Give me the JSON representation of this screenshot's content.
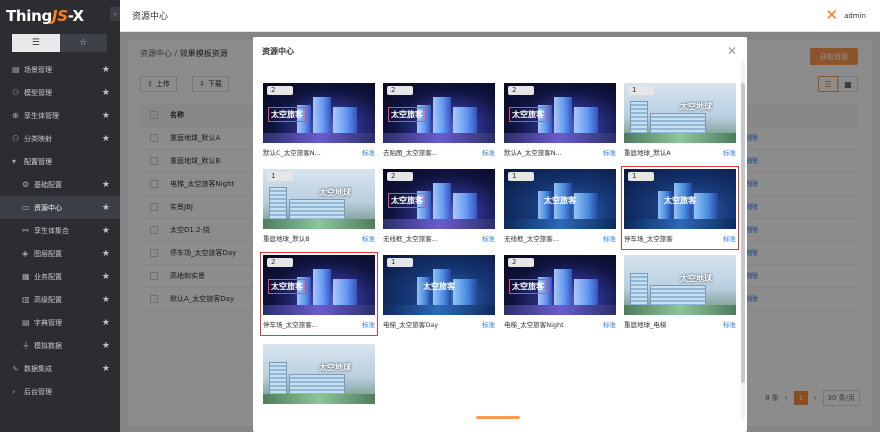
{
  "app": {
    "logo_main": "Thing",
    "logo_js": "JS",
    "logo_x": "-X"
  },
  "sidebar": {
    "collapse_icon": "‹",
    "mode_list_icon": "☰",
    "mode_fav_icon": "☆",
    "items": [
      {
        "label": "场景管理",
        "icon": "▤",
        "star": "★"
      },
      {
        "label": "模型管理",
        "icon": "⚇",
        "star": "★"
      },
      {
        "label": "孪生体管理",
        "icon": "⊕",
        "star": "★"
      },
      {
        "label": "分类映射",
        "icon": "⚇",
        "star": "★"
      },
      {
        "label": "配置管理",
        "icon": "▾",
        "star": ""
      },
      {
        "label": "基础配置",
        "icon": "⚙",
        "star": "★"
      },
      {
        "label": "资源中心",
        "icon": "▭",
        "star": "★"
      },
      {
        "label": "孪生体集合",
        "icon": "⚯",
        "star": "★"
      },
      {
        "label": "图层配置",
        "icon": "◈",
        "star": "★"
      },
      {
        "label": "业务配置",
        "icon": "▦",
        "star": "★"
      },
      {
        "label": "高级配置",
        "icon": "▥",
        "star": "★"
      },
      {
        "label": "字典管理",
        "icon": "▤",
        "star": "★"
      },
      {
        "label": "模拟数据",
        "icon": "⏚",
        "star": "★"
      },
      {
        "label": "数据集成",
        "icon": "∿",
        "star": "★"
      },
      {
        "label": "后台管理",
        "icon": "›",
        "star": ""
      }
    ]
  },
  "topbar": {
    "title": "资源中心",
    "user": "admin"
  },
  "page": {
    "crumb_root": "资源中心",
    "crumb_sep": " / ",
    "crumb_current": "效果模板资源",
    "get_button": "获取资源",
    "upload": "上传",
    "download": "下载",
    "column_name": "名称",
    "rows": [
      "重庭地球_默认A",
      "重庭地球_默认B",
      "电梯_太空旅客Night",
      "实景JBJ",
      "太空D1.2-绕",
      "停车场_太空旅客Day",
      "高地和实景",
      "默认A_太空旅客Day"
    ],
    "row_action": "删除",
    "row_extra_action": "下载",
    "pager_total": "8 条",
    "pager_page": "1",
    "pager_size": "30 条/页"
  },
  "modal": {
    "title": "资源中心",
    "close_icon": "✕",
    "cards": [
      {
        "name": "默认C_太空旅客N...",
        "tag": "标准",
        "badge": "2",
        "style": "night",
        "overlay": "太空旅客",
        "selected": false
      },
      {
        "name": "去贴图_太空旅客...",
        "tag": "标准",
        "badge": "2",
        "style": "night",
        "overlay": "太空旅客",
        "selected": false
      },
      {
        "name": "默认A_太空旅客N...",
        "tag": "标准",
        "badge": "2",
        "style": "night",
        "overlay": "太空旅客",
        "selected": false
      },
      {
        "name": "重庭地球_默认A",
        "tag": "标准",
        "badge": "1",
        "style": "day",
        "overlay": "太空地球",
        "selected": false
      },
      {
        "name": "重庭地球_默认B",
        "tag": "标准",
        "badge": "1",
        "style": "day",
        "overlay": "太空地球",
        "selected": false
      },
      {
        "name": "无线框_太空旅客...",
        "tag": "标准",
        "badge": "2",
        "style": "night",
        "overlay": "太空旅客",
        "selected": false
      },
      {
        "name": "无线框_太空旅客...",
        "tag": "标准",
        "badge": "1",
        "style": "blue",
        "overlay": "太空旅客",
        "selected": false
      },
      {
        "name": "停车场_太空旅客",
        "tag": "标准",
        "badge": "1",
        "style": "blue",
        "overlay": "太空旅客",
        "selected": true
      },
      {
        "name": "停车场_太空旅客...",
        "tag": "标准",
        "badge": "2",
        "style": "night",
        "overlay": "太空旅客",
        "selected": true
      },
      {
        "name": "电梯_太空旅客Day",
        "tag": "标准",
        "badge": "1",
        "style": "blue",
        "overlay": "太空旅客",
        "selected": false
      },
      {
        "name": "电梯_太空旅客Night",
        "tag": "标准",
        "badge": "2",
        "style": "night",
        "overlay": "太空旅客",
        "selected": false
      },
      {
        "name": "重庭地球_电梯",
        "tag": "标准",
        "badge": "",
        "style": "day",
        "overlay": "太空地球",
        "selected": false
      },
      {
        "name": "",
        "tag": "",
        "badge": "",
        "style": "day",
        "overlay": "太空地球",
        "selected": false
      }
    ]
  }
}
